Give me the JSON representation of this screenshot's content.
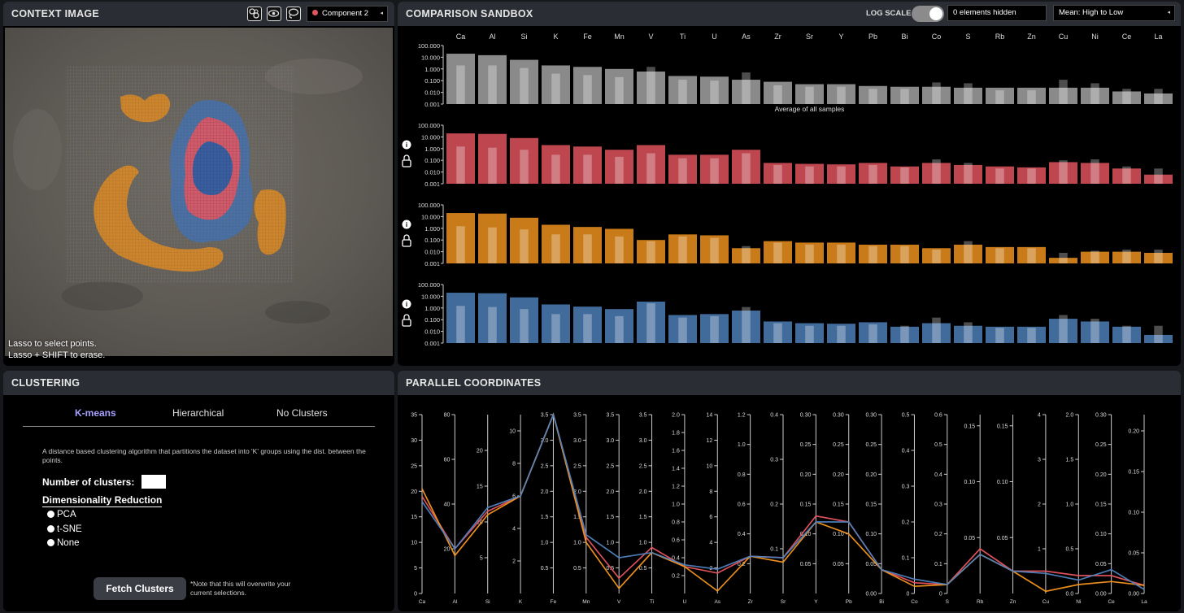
{
  "context": {
    "title": "CONTEXT IMAGE",
    "component_label": "Component 2",
    "component_color": "#e05560",
    "hint_line1": "Lasso to select points.",
    "hint_line2": "Lasso + SHIFT to erase.",
    "icons": [
      "layers-icon",
      "eye-icon",
      "lasso-icon"
    ]
  },
  "sandbox": {
    "title": "COMPARISON SANDBOX",
    "log_scale_label": "LOG SCALE",
    "log_scale_on": true,
    "hidden_text": "0 elements hidden",
    "sort_label": "Mean: High to Low"
  },
  "clustering": {
    "title": "CLUSTERING",
    "tabs": [
      "K-means",
      "Hierarchical",
      "No Clusters"
    ],
    "active_tab": 0,
    "description": "A distance based clustering algorithm that partitions the dataset into 'K' groups using the dist. between the points.",
    "num_clusters_label": "Number of clusters:",
    "dim_reduction_label": "Dimensionality Reduction",
    "dim_options": [
      "PCA",
      "t-SNE",
      "None"
    ],
    "fetch_label": "Fetch Clusters",
    "fetch_note": "*Note that this will overwrite your current selections."
  },
  "parallel": {
    "title": "PARALLEL COORDINATES"
  },
  "colors": {
    "gray": "#a8a8a8",
    "red": "#e85560",
    "orange": "#f5961e",
    "blue": "#4f82bd",
    "accent": "#a7a0ff"
  },
  "chart_data": [
    {
      "type": "bar",
      "scale": "log",
      "ylim": [
        0.001,
        100
      ],
      "yticks": [
        "100.000",
        "10.000",
        "1.000",
        "0.100",
        "0.010",
        "0.001"
      ],
      "categories": [
        "Ca",
        "Al",
        "Si",
        "K",
        "Fe",
        "Mn",
        "V",
        "Ti",
        "U",
        "As",
        "Zr",
        "Sr",
        "Y",
        "Pb",
        "Bi",
        "Co",
        "S",
        "Rb",
        "Zn",
        "Cu",
        "Ni",
        "Ce",
        "La"
      ],
      "series": [
        {
          "name": "Average of all samples",
          "color": "gray",
          "values": [
            20,
            15,
            6,
            2,
            1.5,
            1,
            0.6,
            0.25,
            0.22,
            0.12,
            0.08,
            0.05,
            0.05,
            0.035,
            0.03,
            0.03,
            0.025,
            0.025,
            0.025,
            0.025,
            0.025,
            0.012,
            0.008
          ],
          "inner": [
            2,
            2,
            1.2,
            0.4,
            0.3,
            0.2,
            1.5,
            0.12,
            0.1,
            0.5,
            0.04,
            0.03,
            0.03,
            0.02,
            0.02,
            0.07,
            0.06,
            0.015,
            0.015,
            0.12,
            0.06,
            0.02,
            0.02
          ]
        },
        {
          "color": "red",
          "values": [
            20,
            18,
            8,
            2,
            1.5,
            0.8,
            2,
            0.3,
            0.3,
            0.8,
            0.06,
            0.05,
            0.045,
            0.06,
            0.03,
            0.06,
            0.04,
            0.03,
            0.025,
            0.07,
            0.06,
            0.02,
            0.006
          ],
          "inner": [
            1.5,
            1.2,
            0.8,
            0.3,
            0.3,
            0.2,
            0.4,
            0.15,
            0.15,
            0.4,
            0.04,
            0.03,
            0.03,
            0.04,
            0.025,
            0.12,
            0.06,
            0.02,
            0.02,
            0.1,
            0.12,
            0.03,
            0.02
          ]
        },
        {
          "color": "orange",
          "values": [
            20,
            18,
            8,
            2,
            1.3,
            0.9,
            0.1,
            0.3,
            0.25,
            0.02,
            0.08,
            0.06,
            0.06,
            0.04,
            0.04,
            0.02,
            0.04,
            0.025,
            0.025,
            0.003,
            0.01,
            0.01,
            0.008
          ],
          "inner": [
            1.5,
            1.2,
            0.8,
            0.3,
            0.3,
            0.2,
            0.08,
            0.2,
            0.15,
            0.03,
            0.06,
            0.04,
            0.04,
            0.03,
            0.03,
            0.015,
            0.08,
            0.02,
            0.02,
            0.008,
            0.012,
            0.015,
            0.015
          ]
        },
        {
          "color": "blue",
          "values": [
            20,
            18,
            8,
            2,
            1.3,
            0.8,
            3.5,
            0.25,
            0.3,
            0.6,
            0.07,
            0.05,
            0.045,
            0.06,
            0.025,
            0.05,
            0.03,
            0.025,
            0.025,
            0.12,
            0.07,
            0.025,
            0.005
          ],
          "inner": [
            1.5,
            1.2,
            0.8,
            0.3,
            0.3,
            0.2,
            2.5,
            0.15,
            0.2,
            1.2,
            0.05,
            0.03,
            0.03,
            0.04,
            0.03,
            0.15,
            0.06,
            0.02,
            0.02,
            0.25,
            0.12,
            0.03,
            0.03
          ]
        }
      ],
      "axis_title": "Average of all samples"
    },
    {
      "type": "line",
      "axes": [
        {
          "name": "Ca",
          "max": 35,
          "ticks": [
            0,
            5,
            10,
            15,
            20,
            25,
            30,
            35
          ]
        },
        {
          "name": "Al",
          "max": 80,
          "ticks": [
            20,
            40,
            60,
            80
          ]
        },
        {
          "name": "Si",
          "max": 25,
          "ticks": [
            5,
            10,
            15,
            20
          ]
        },
        {
          "name": "K",
          "max": 11,
          "ticks": [
            2,
            4,
            6,
            8,
            10
          ]
        },
        {
          "name": "Fe",
          "max": 3.5,
          "ticks": [
            0.5,
            1.0,
            1.5,
            2.0,
            2.5,
            3.0,
            3.5
          ]
        },
        {
          "name": "Mn",
          "max": 3.5,
          "ticks": [
            0.5,
            1.0,
            1.5,
            2.0,
            2.5,
            3.0,
            3.5
          ]
        },
        {
          "name": "V",
          "max": 3.5,
          "ticks": [
            0.5,
            1.0,
            1.5,
            2.0,
            2.5,
            3.0,
            3.5
          ]
        },
        {
          "name": "Ti",
          "max": 3.5,
          "ticks": [
            0.5,
            1.0,
            1.5,
            2.0,
            2.5,
            3.0,
            3.5
          ]
        },
        {
          "name": "U",
          "max": 2.0,
          "ticks": [
            0.2,
            0.4,
            0.6,
            0.8,
            1.0,
            1.2,
            1.4,
            1.6,
            1.8,
            2.0
          ]
        },
        {
          "name": "As",
          "max": 14,
          "ticks": [
            2,
            4,
            6,
            8,
            10,
            12,
            14
          ]
        },
        {
          "name": "Zr",
          "max": 1.2,
          "ticks": [
            0.2,
            0.4,
            0.6,
            0.8,
            1.0,
            1.2
          ]
        },
        {
          "name": "Sr",
          "max": 0.4,
          "ticks": [
            0.1,
            0.2,
            0.3,
            0.4
          ]
        },
        {
          "name": "Y",
          "max": 0.3,
          "ticks": [
            0.05,
            0.1,
            0.15,
            0.2,
            0.25,
            0.3
          ]
        },
        {
          "name": "Pb",
          "max": 0.3,
          "ticks": [
            0.05,
            0.1,
            0.15,
            0.2,
            0.25,
            0.3
          ]
        },
        {
          "name": "Bi",
          "max": 0.3,
          "ticks": [
            0.0,
            0.05,
            0.1,
            0.15,
            0.2,
            0.25,
            0.3
          ]
        },
        {
          "name": "Co",
          "max": 0.5,
          "ticks": [
            0.0,
            0.1,
            0.2,
            0.3,
            0.4,
            0.5
          ]
        },
        {
          "name": "S",
          "max": 0.6,
          "ticks": [
            0.0,
            0.1,
            0.2,
            0.3,
            0.4,
            0.5,
            0.6
          ]
        },
        {
          "name": "Rb",
          "max": 0.16,
          "ticks": [
            0.05,
            0.1,
            0.15
          ]
        },
        {
          "name": "Zn",
          "max": 0.16,
          "ticks": [
            0.05,
            0.1,
            0.15
          ]
        },
        {
          "name": "Cu",
          "max": 4,
          "ticks": [
            1,
            2,
            3,
            4
          ]
        },
        {
          "name": "Ni",
          "max": 2.0,
          "ticks": [
            0.0,
            0.5,
            1.0,
            1.5,
            2.0
          ]
        },
        {
          "name": "Ce",
          "max": 0.3,
          "ticks": [
            0.0,
            0.05,
            0.1,
            0.15,
            0.2,
            0.25,
            0.3
          ]
        },
        {
          "name": "La",
          "max": 0.22,
          "ticks": [
            0.0,
            0.05,
            0.1,
            0.15,
            0.2
          ]
        }
      ],
      "series": [
        {
          "color": "red",
          "values": [
            19,
            20,
            11.5,
            6,
            4.5,
            1.1,
            0.3,
            0.9,
            0.3,
            1.6,
            0.25,
            0.08,
            0.13,
            0.12,
            0.04,
            0.03,
            0.03,
            0.04,
            0.02,
            0.5,
            0.2,
            0.03,
            0.01
          ]
        },
        {
          "color": "orange",
          "values": [
            20.5,
            17,
            11,
            6,
            5,
            1,
            0.1,
            0.8,
            0.3,
            0.2,
            0.25,
            0.07,
            0.12,
            0.1,
            0.04,
            0.02,
            0.03,
            0.035,
            0.02,
            0.05,
            0.1,
            0.02,
            0.01
          ]
        },
        {
          "color": "blue",
          "values": [
            18,
            20,
            12,
            6,
            4.2,
            1.15,
            0.7,
            0.8,
            0.32,
            1.9,
            0.25,
            0.08,
            0.12,
            0.12,
            0.04,
            0.04,
            0.03,
            0.035,
            0.02,
            0.45,
            0.15,
            0.04,
            0.005
          ]
        }
      ]
    }
  ]
}
